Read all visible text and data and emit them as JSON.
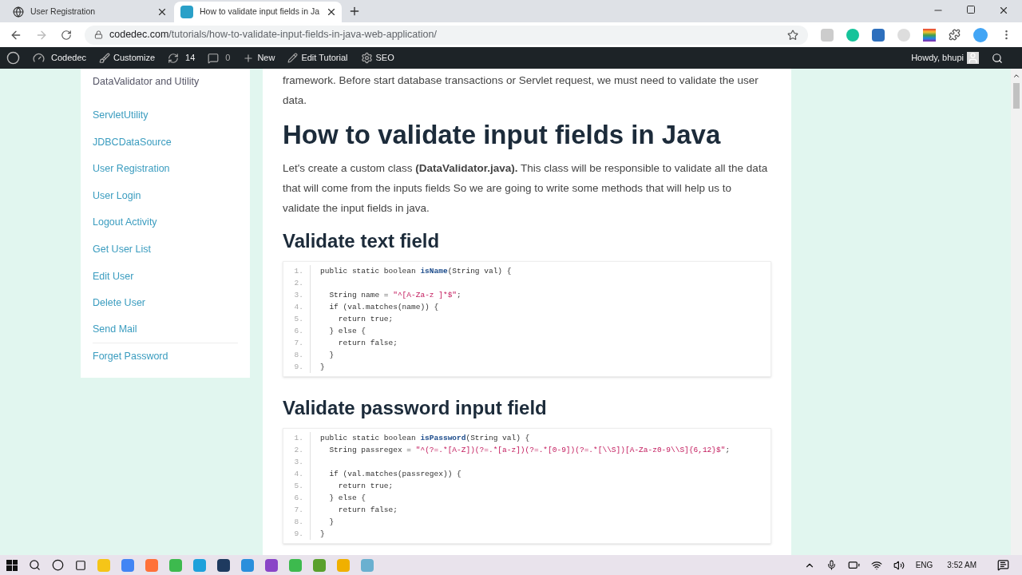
{
  "browser": {
    "tabs": [
      {
        "title": "User Registration",
        "selected": false
      },
      {
        "title": "How to validate input fields in Ja",
        "selected": true
      }
    ],
    "url_domain": "codedec.com",
    "url_path": "/tutorials/how-to-validate-input-fields-in-java-web-application/"
  },
  "admin_bar": {
    "site": "Codedec",
    "customize": "Customize",
    "updates": "14",
    "comments": "0",
    "new": "New",
    "edit": "Edit Tutorial",
    "seo": "SEO",
    "greeting": "Howdy, bhupi"
  },
  "sidebar": {
    "items": [
      "DataValidator and Utility",
      "ServletUtility",
      "JDBCDataSource",
      "User Registration",
      "User Login",
      "Logout Activity",
      "Get User List",
      "Edit User",
      "Delete User",
      "Send Mail",
      "Forget Password"
    ]
  },
  "article": {
    "intro": "framework. Before start database transactions or Servlet request, we must need to validate the user data.",
    "heading": "How to validate input fields in Java",
    "paragraph": "Let's create a custom class **(DataValidator.java).** This class will be responsible to validate all the data that will come from the inputs fields So we are going to write some methods that will help us to validate the input fields in java.",
    "sections": [
      {
        "title": "Validate text field",
        "code": [
          {
            "number": "1.",
            "parts": [
              {
                "kind": "plain",
                "text": "public static boolean "
              },
              {
                "kind": "method",
                "text": "isName"
              },
              {
                "kind": "plain",
                "text": "(String val) {"
              }
            ]
          },
          {
            "number": "2."
          },
          {
            "number": "3.",
            "parts": [
              {
                "kind": "plain",
                "text": "  String name = "
              },
              {
                "kind": "string",
                "text": "\"^[A-Za-z ]*$\""
              },
              {
                "kind": "plain",
                "text": ";"
              }
            ]
          },
          {
            "number": "4.",
            "parts": [
              {
                "kind": "plain",
                "text": "  if (val.matches(name)) {"
              }
            ]
          },
          {
            "number": "5.",
            "parts": [
              {
                "kind": "plain",
                "text": "    return true;"
              }
            ]
          },
          {
            "number": "6.",
            "parts": [
              {
                "kind": "plain",
                "text": "  } else {"
              }
            ]
          },
          {
            "number": "7.",
            "parts": [
              {
                "kind": "plain",
                "text": "    return false;"
              }
            ]
          },
          {
            "number": "8.",
            "parts": [
              {
                "kind": "plain",
                "text": "  }"
              }
            ]
          },
          {
            "number": "9.",
            "parts": [
              {
                "kind": "plain",
                "text": "}"
              }
            ]
          }
        ]
      },
      {
        "title": "Validate password input field",
        "code": [
          {
            "number": "1.",
            "parts": [
              {
                "kind": "plain",
                "text": "public static boolean "
              },
              {
                "kind": "method",
                "text": "isPassword"
              },
              {
                "kind": "plain",
                "text": "(String val) {"
              }
            ]
          },
          {
            "number": "2.",
            "parts": [
              {
                "kind": "plain",
                "text": "  String passregex = "
              },
              {
                "kind": "string",
                "text": "\"^(?=.*[A-Z])(?=.*[a-z])(?=.*[0-9])(?=.*[\\\\S])[A-Za-z0-9\\\\S]{6,12}$\""
              },
              {
                "kind": "plain",
                "text": ";"
              }
            ]
          },
          {
            "number": "3."
          },
          {
            "number": "4.",
            "parts": [
              {
                "kind": "plain",
                "text": "  if (val.matches(passregex)) {"
              }
            ]
          },
          {
            "number": "5.",
            "parts": [
              {
                "kind": "plain",
                "text": "    return true;"
              }
            ]
          },
          {
            "number": "6.",
            "parts": [
              {
                "kind": "plain",
                "text": "  } else {"
              }
            ]
          },
          {
            "number": "7.",
            "parts": [
              {
                "kind": "plain",
                "text": "    return false;"
              }
            ]
          },
          {
            "number": "8.",
            "parts": [
              {
                "kind": "plain",
                "text": "  }"
              }
            ]
          },
          {
            "number": "9.",
            "parts": [
              {
                "kind": "plain",
                "text": "}"
              }
            ]
          }
        ]
      }
    ]
  },
  "taskbar": {
    "language": "ENG",
    "time": "3:52 AM"
  }
}
